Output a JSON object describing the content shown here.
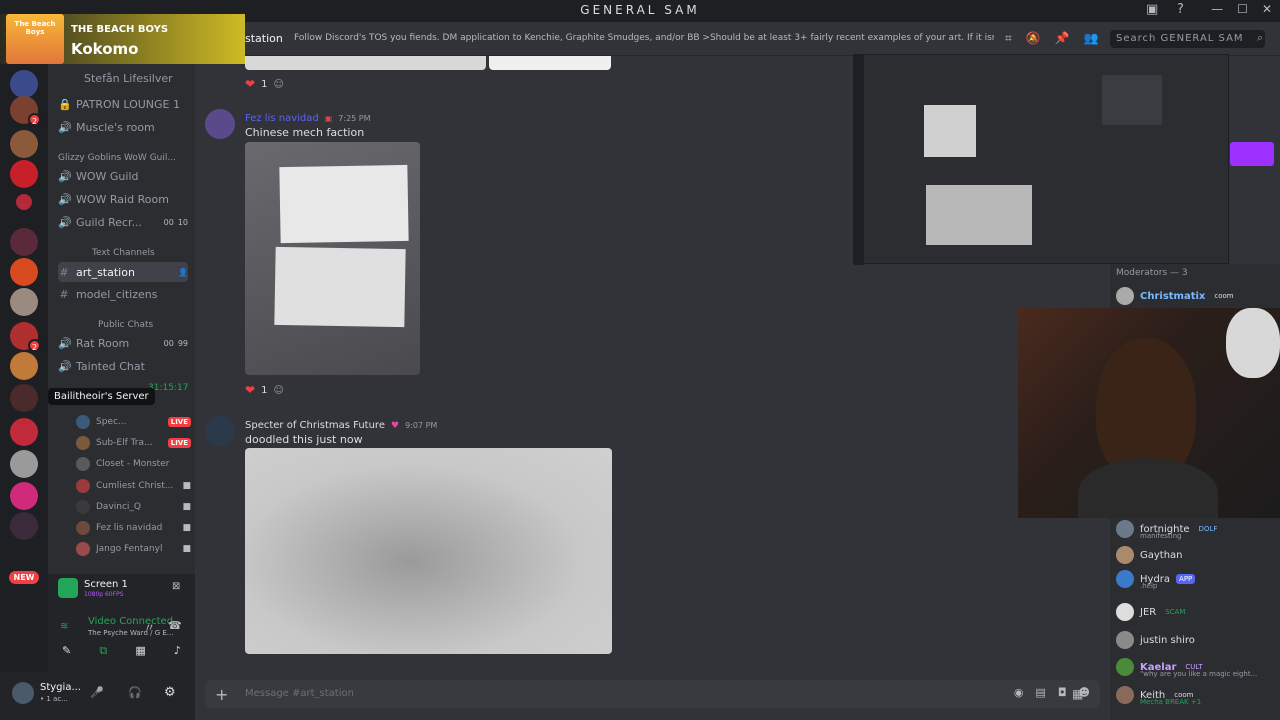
{
  "window": {
    "title": "GENERAL SAM"
  },
  "now_playing": {
    "artist": "THE BEACH BOYS",
    "song": "Kokomo",
    "album_art_text": "The Beach Boys"
  },
  "channel_header": {
    "name": "station",
    "topic": "Follow Discord's TOS you fiends. DM application to Kenchie, Graphite Smudges, and/or BB >Should be at least 3+ fairly recent examples of your art. If it isn't yours, you su...",
    "search_placeholder": "Search GENERAL SAM"
  },
  "sidebar": {
    "items": [
      {
        "kind": "user",
        "label": "Stefån Lifesilver"
      },
      {
        "kind": "channel",
        "icon": "lock-icon",
        "label": "PATRON LOUNGE 1"
      },
      {
        "kind": "channel",
        "icon": "speaker-icon",
        "label": "Muscle's room"
      },
      {
        "kind": "category",
        "label": "Glizzy Goblins WoW Guil..."
      },
      {
        "kind": "channel",
        "icon": "speaker-icon",
        "label": "WOW Guild"
      },
      {
        "kind": "channel",
        "icon": "speaker-icon",
        "label": "WOW Raid Room"
      },
      {
        "kind": "channel",
        "icon": "speaker-icon",
        "label": "Guild Recr...",
        "counts": [
          "00",
          "10"
        ]
      },
      {
        "kind": "category",
        "label": "Text Channels"
      },
      {
        "kind": "channel",
        "icon": "hash-icon",
        "label": "art_station",
        "active": true
      },
      {
        "kind": "channel",
        "icon": "hash-icon",
        "label": "model_citizens"
      },
      {
        "kind": "category",
        "label": "Public Chats"
      },
      {
        "kind": "channel",
        "icon": "speaker-icon",
        "label": "Rat Room",
        "counts": [
          "00",
          "99"
        ]
      },
      {
        "kind": "channel",
        "icon": "speaker-icon",
        "label": "Tainted Chat"
      }
    ],
    "voice_timer": "31:15:17",
    "tooltip": "Bailitheoir's Server",
    "voice_users": [
      {
        "name": "Spec...",
        "live": "LIVE"
      },
      {
        "name": "Sub-Elf Tra...",
        "live": "LIVE"
      },
      {
        "name": "Closet - Monster"
      },
      {
        "name": "Cumliest Christ..."
      },
      {
        "name": "Davinci_Q"
      },
      {
        "name": "Fez lis navidad"
      },
      {
        "name": "Jango Fentanyl"
      }
    ],
    "new_badge": "NEW",
    "badge_counts": [
      "2",
      "2"
    ]
  },
  "stream_card": {
    "title": "Screen 1",
    "quality": "1080p 60FPS",
    "status": "Video Connected",
    "location": "The Psyche Ward / G E..."
  },
  "user_bar": {
    "name": "Stygia...",
    "status": "• 1 ac..."
  },
  "messages": [
    {
      "author": "Fez lis navidad",
      "time": "7:25 PM",
      "text": "Chinese mech faction",
      "reactions": "1",
      "author_color": "#5865f2"
    },
    {
      "author": "Specter of Christmas Future",
      "time": "9:07 PM",
      "text": "doodled this just now",
      "author_color": "#dbdee1"
    }
  ],
  "top_reaction_count": "1",
  "composer": {
    "placeholder": "Message #art_station"
  },
  "members": {
    "moderators_header": "Moderators — 3",
    "list": [
      {
        "name": "Christmatix",
        "tag": "coom"
      },
      {
        "name": "fortnighte",
        "tag": "DOLF",
        "sub": "manifesting"
      },
      {
        "name": "Gaythan"
      },
      {
        "name": "Hydra",
        "tag": "APP",
        "sub": ".help"
      },
      {
        "name": "JER",
        "tag": "SCAM"
      },
      {
        "name": "justin shiro"
      },
      {
        "name": "Kaelar",
        "tag": "CULT",
        "sub": "\"why are you like a magic eight..."
      },
      {
        "name": "Keith",
        "tag": "coom",
        "sub": "Mecha BREAK +1"
      }
    ]
  },
  "colors": {
    "accent": "#5865f2",
    "live": "#f23f43",
    "bg": "#313338",
    "online": "#23a55a"
  }
}
